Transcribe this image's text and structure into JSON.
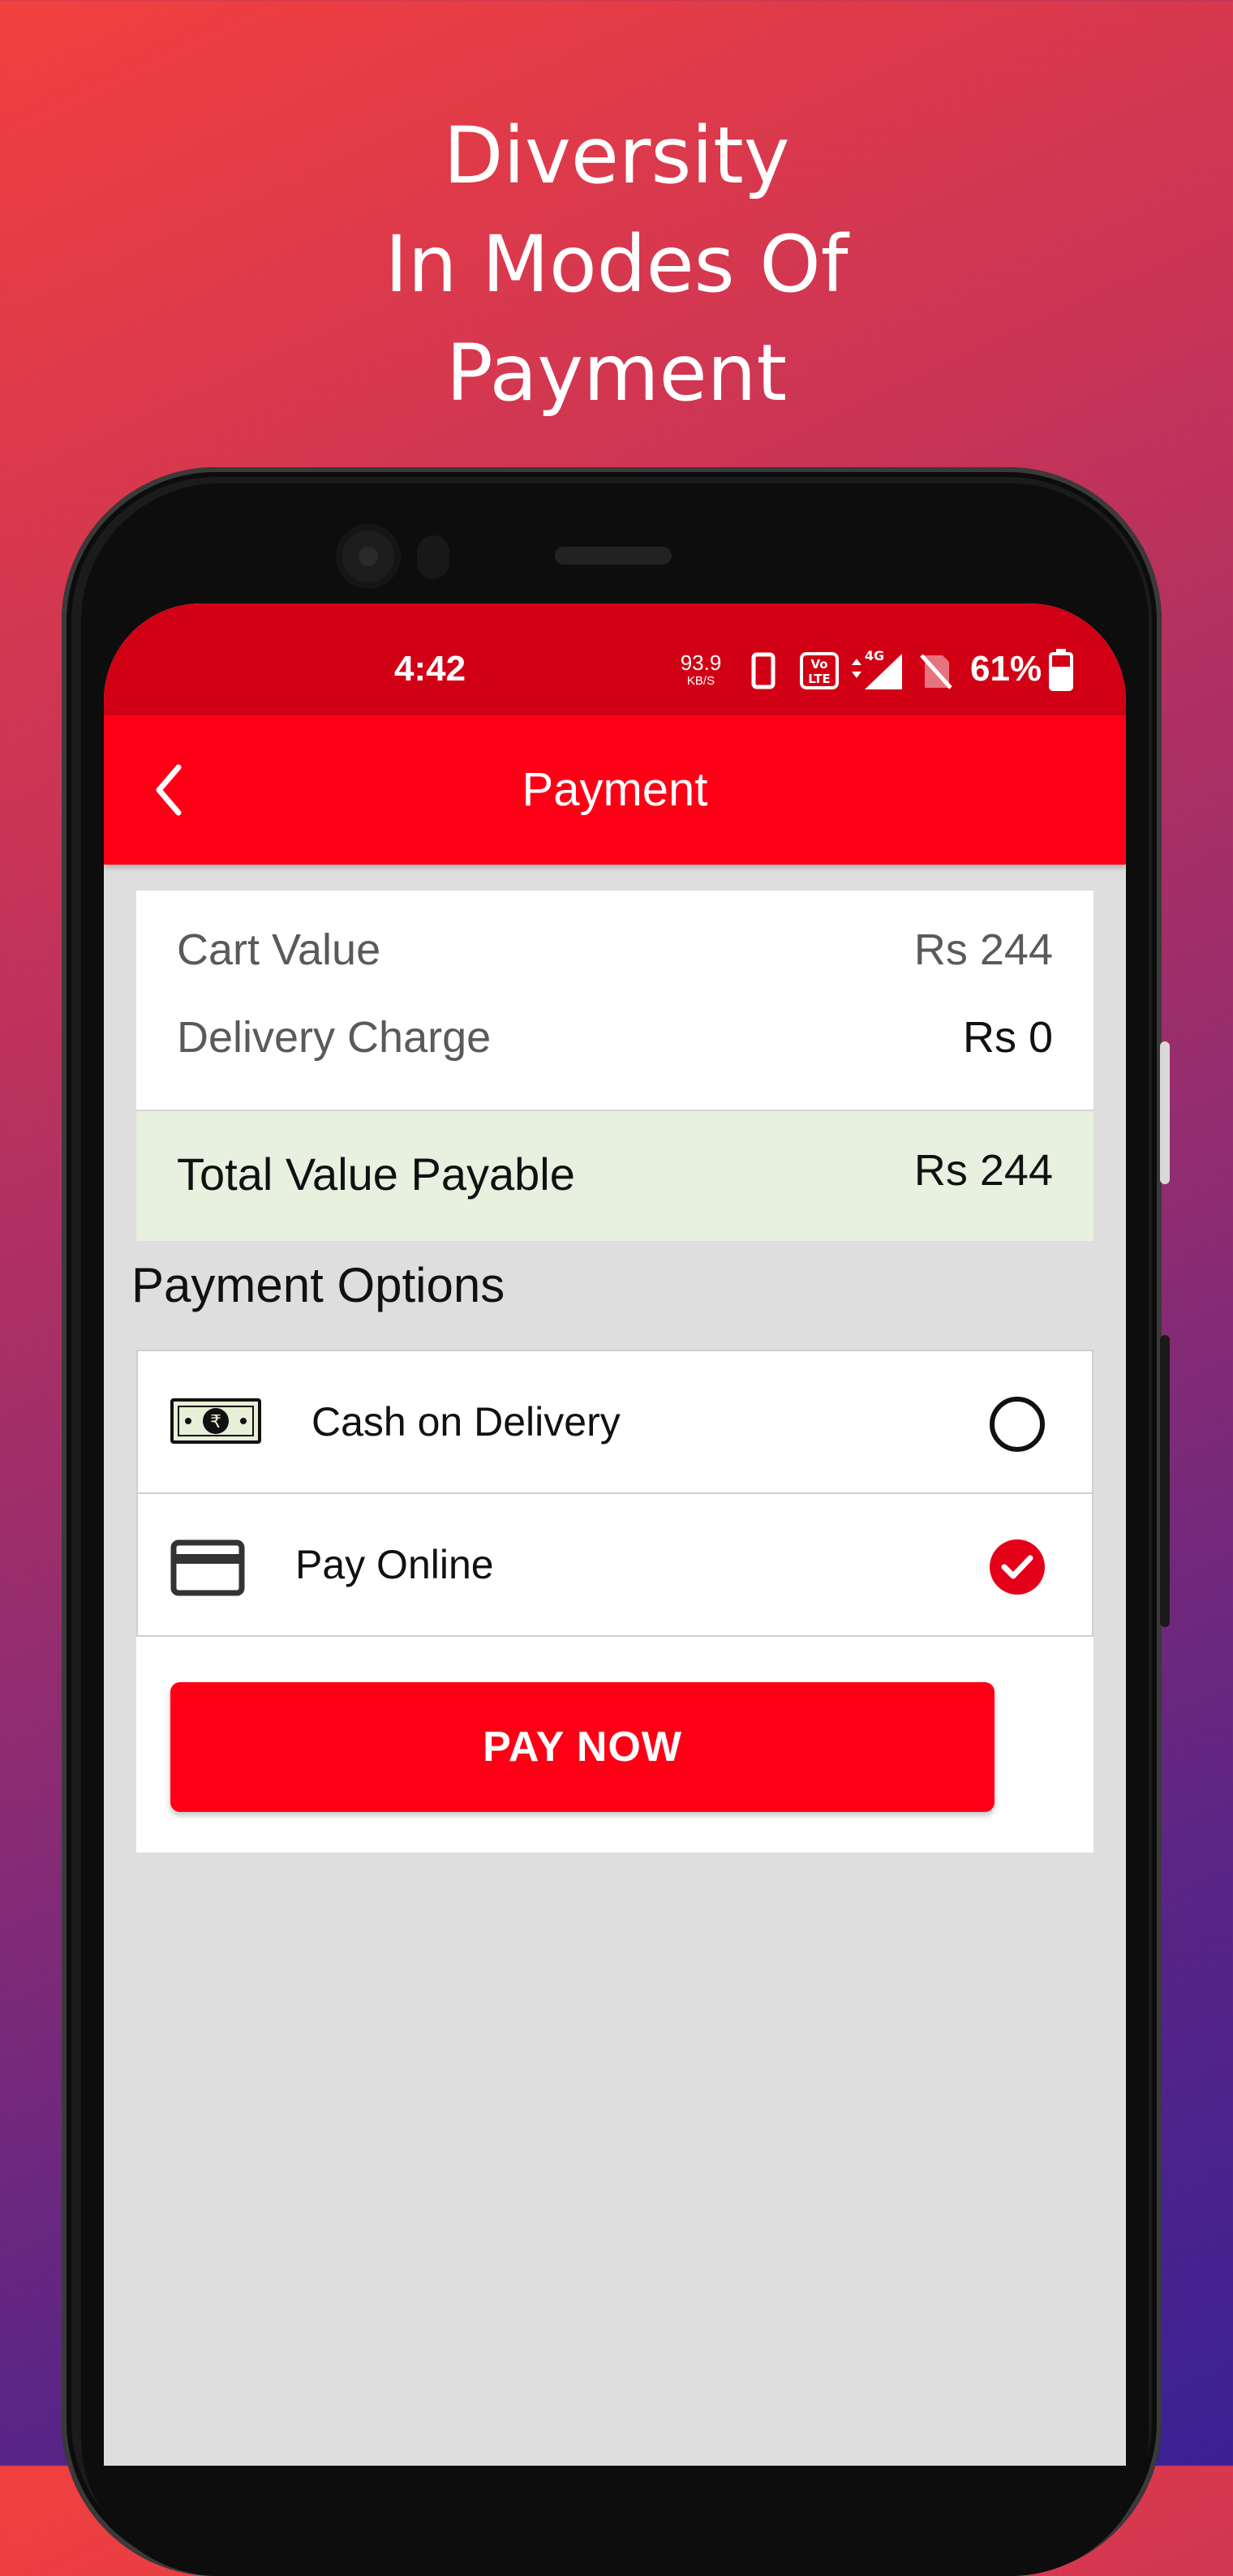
{
  "headline": {
    "line1": "Diversity",
    "line2": "In Modes Of",
    "line3": "Payment"
  },
  "status_bar": {
    "time": "4:42",
    "net_speed": "93.9",
    "net_speed_unit": "KB/S",
    "network_type": "4G",
    "battery_percent": "61%"
  },
  "app_bar": {
    "title": "Payment",
    "back_icon": "chevron-left-icon"
  },
  "summary": {
    "cart_value_label": "Cart Value",
    "cart_value": "Rs 244",
    "delivery_label": "Delivery Charge",
    "delivery_value": "Rs 0",
    "total_label": "Total Value Payable",
    "total_value": "Rs 244"
  },
  "payment_options": {
    "title": "Payment Options",
    "items": [
      {
        "label": "Cash on Delivery",
        "icon": "cash-note-icon",
        "selected": false
      },
      {
        "label": "Pay Online",
        "icon": "credit-card-icon",
        "selected": true
      }
    ]
  },
  "pay_button": {
    "label": "PAY NOW"
  },
  "colors": {
    "primary_red": "#fe0016",
    "status_red": "#d20015",
    "total_bg": "#e8f0e0"
  }
}
